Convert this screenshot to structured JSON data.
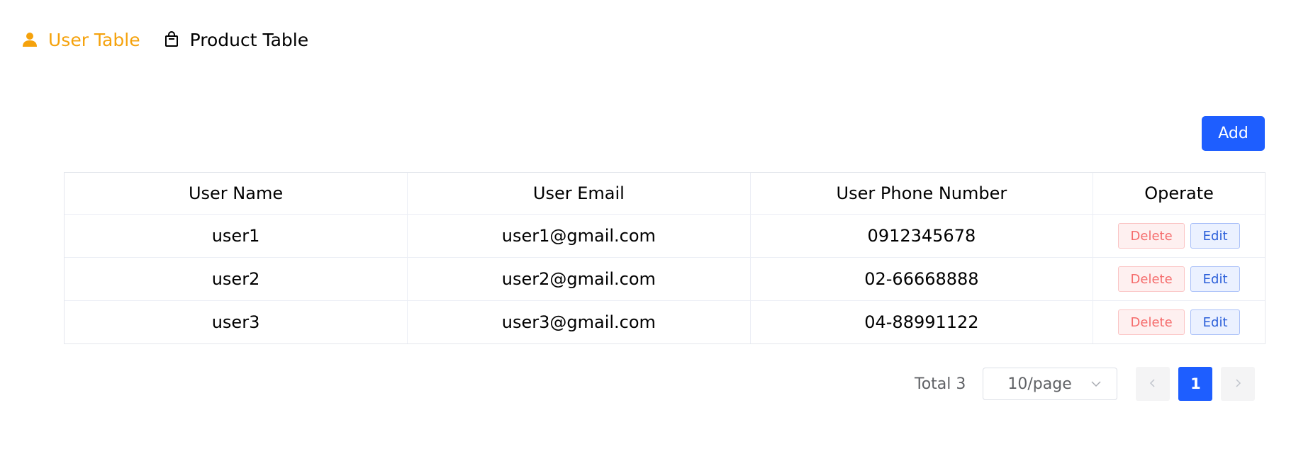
{
  "menu": {
    "items": [
      {
        "label": "User Table",
        "icon": "user-icon",
        "active": true
      },
      {
        "label": "Product Table",
        "icon": "shopping-bag-icon",
        "active": false
      }
    ]
  },
  "toolbar": {
    "add_label": "Add"
  },
  "table": {
    "headers": [
      "User Name",
      "User Email",
      "User Phone Number",
      "Operate"
    ],
    "rows": [
      {
        "name": "user1",
        "email": "user1@gmail.com",
        "phone": "0912345678"
      },
      {
        "name": "user2",
        "email": "user2@gmail.com",
        "phone": "02-66668888"
      },
      {
        "name": "user3",
        "email": "user3@gmail.com",
        "phone": "04-88991122"
      }
    ],
    "delete_label": "Delete",
    "edit_label": "Edit"
  },
  "pagination": {
    "total_text": "Total 3",
    "page_size": "10/page",
    "current_page": "1"
  },
  "colors": {
    "accent": "#f5a20c",
    "primary": "#1e5eff",
    "danger": "#f56c6c"
  }
}
